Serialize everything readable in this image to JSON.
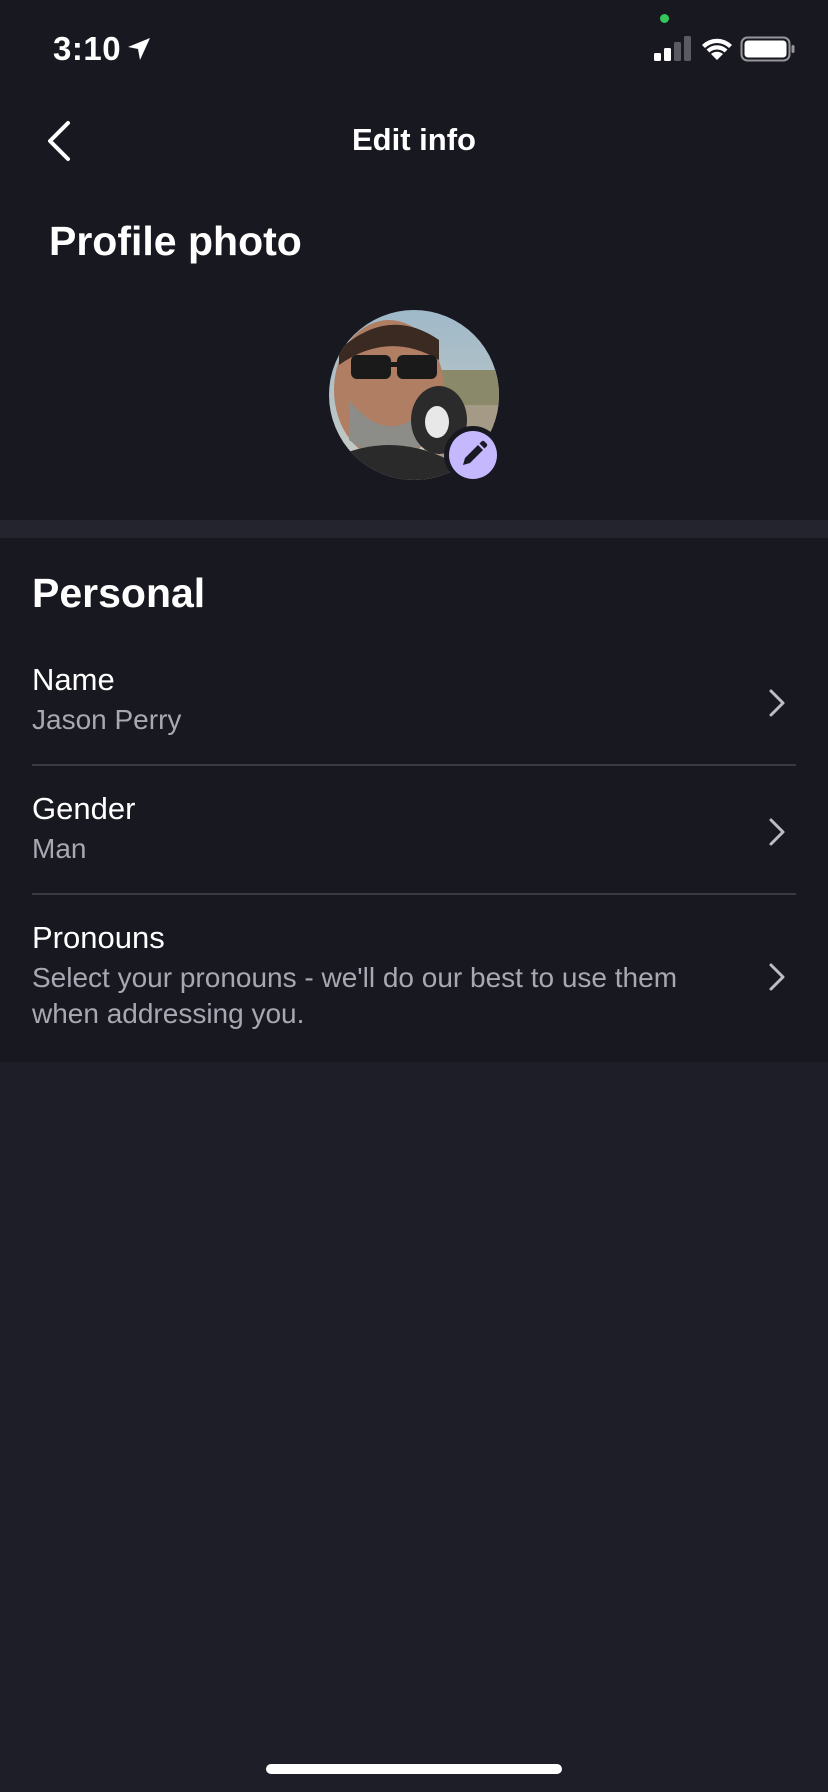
{
  "status_bar": {
    "time": "3:10"
  },
  "header": {
    "title": "Edit info",
    "back_icon": "chevron-left-icon"
  },
  "profile_photo": {
    "heading": "Profile photo",
    "edit_icon": "pencil-icon",
    "badge_color": "#c6b8ff"
  },
  "personal": {
    "heading": "Personal",
    "rows": [
      {
        "label": "Name",
        "value": "Jason Perry"
      },
      {
        "label": "Gender",
        "value": "Man"
      },
      {
        "label": "Pronouns",
        "value": "Select your pronouns - we'll do our best to use them when addressing you."
      }
    ]
  },
  "colors": {
    "background": "#1e1e29",
    "surface": "#181820",
    "secondary_text": "#a8a8b3",
    "accent": "#c6b8ff"
  }
}
